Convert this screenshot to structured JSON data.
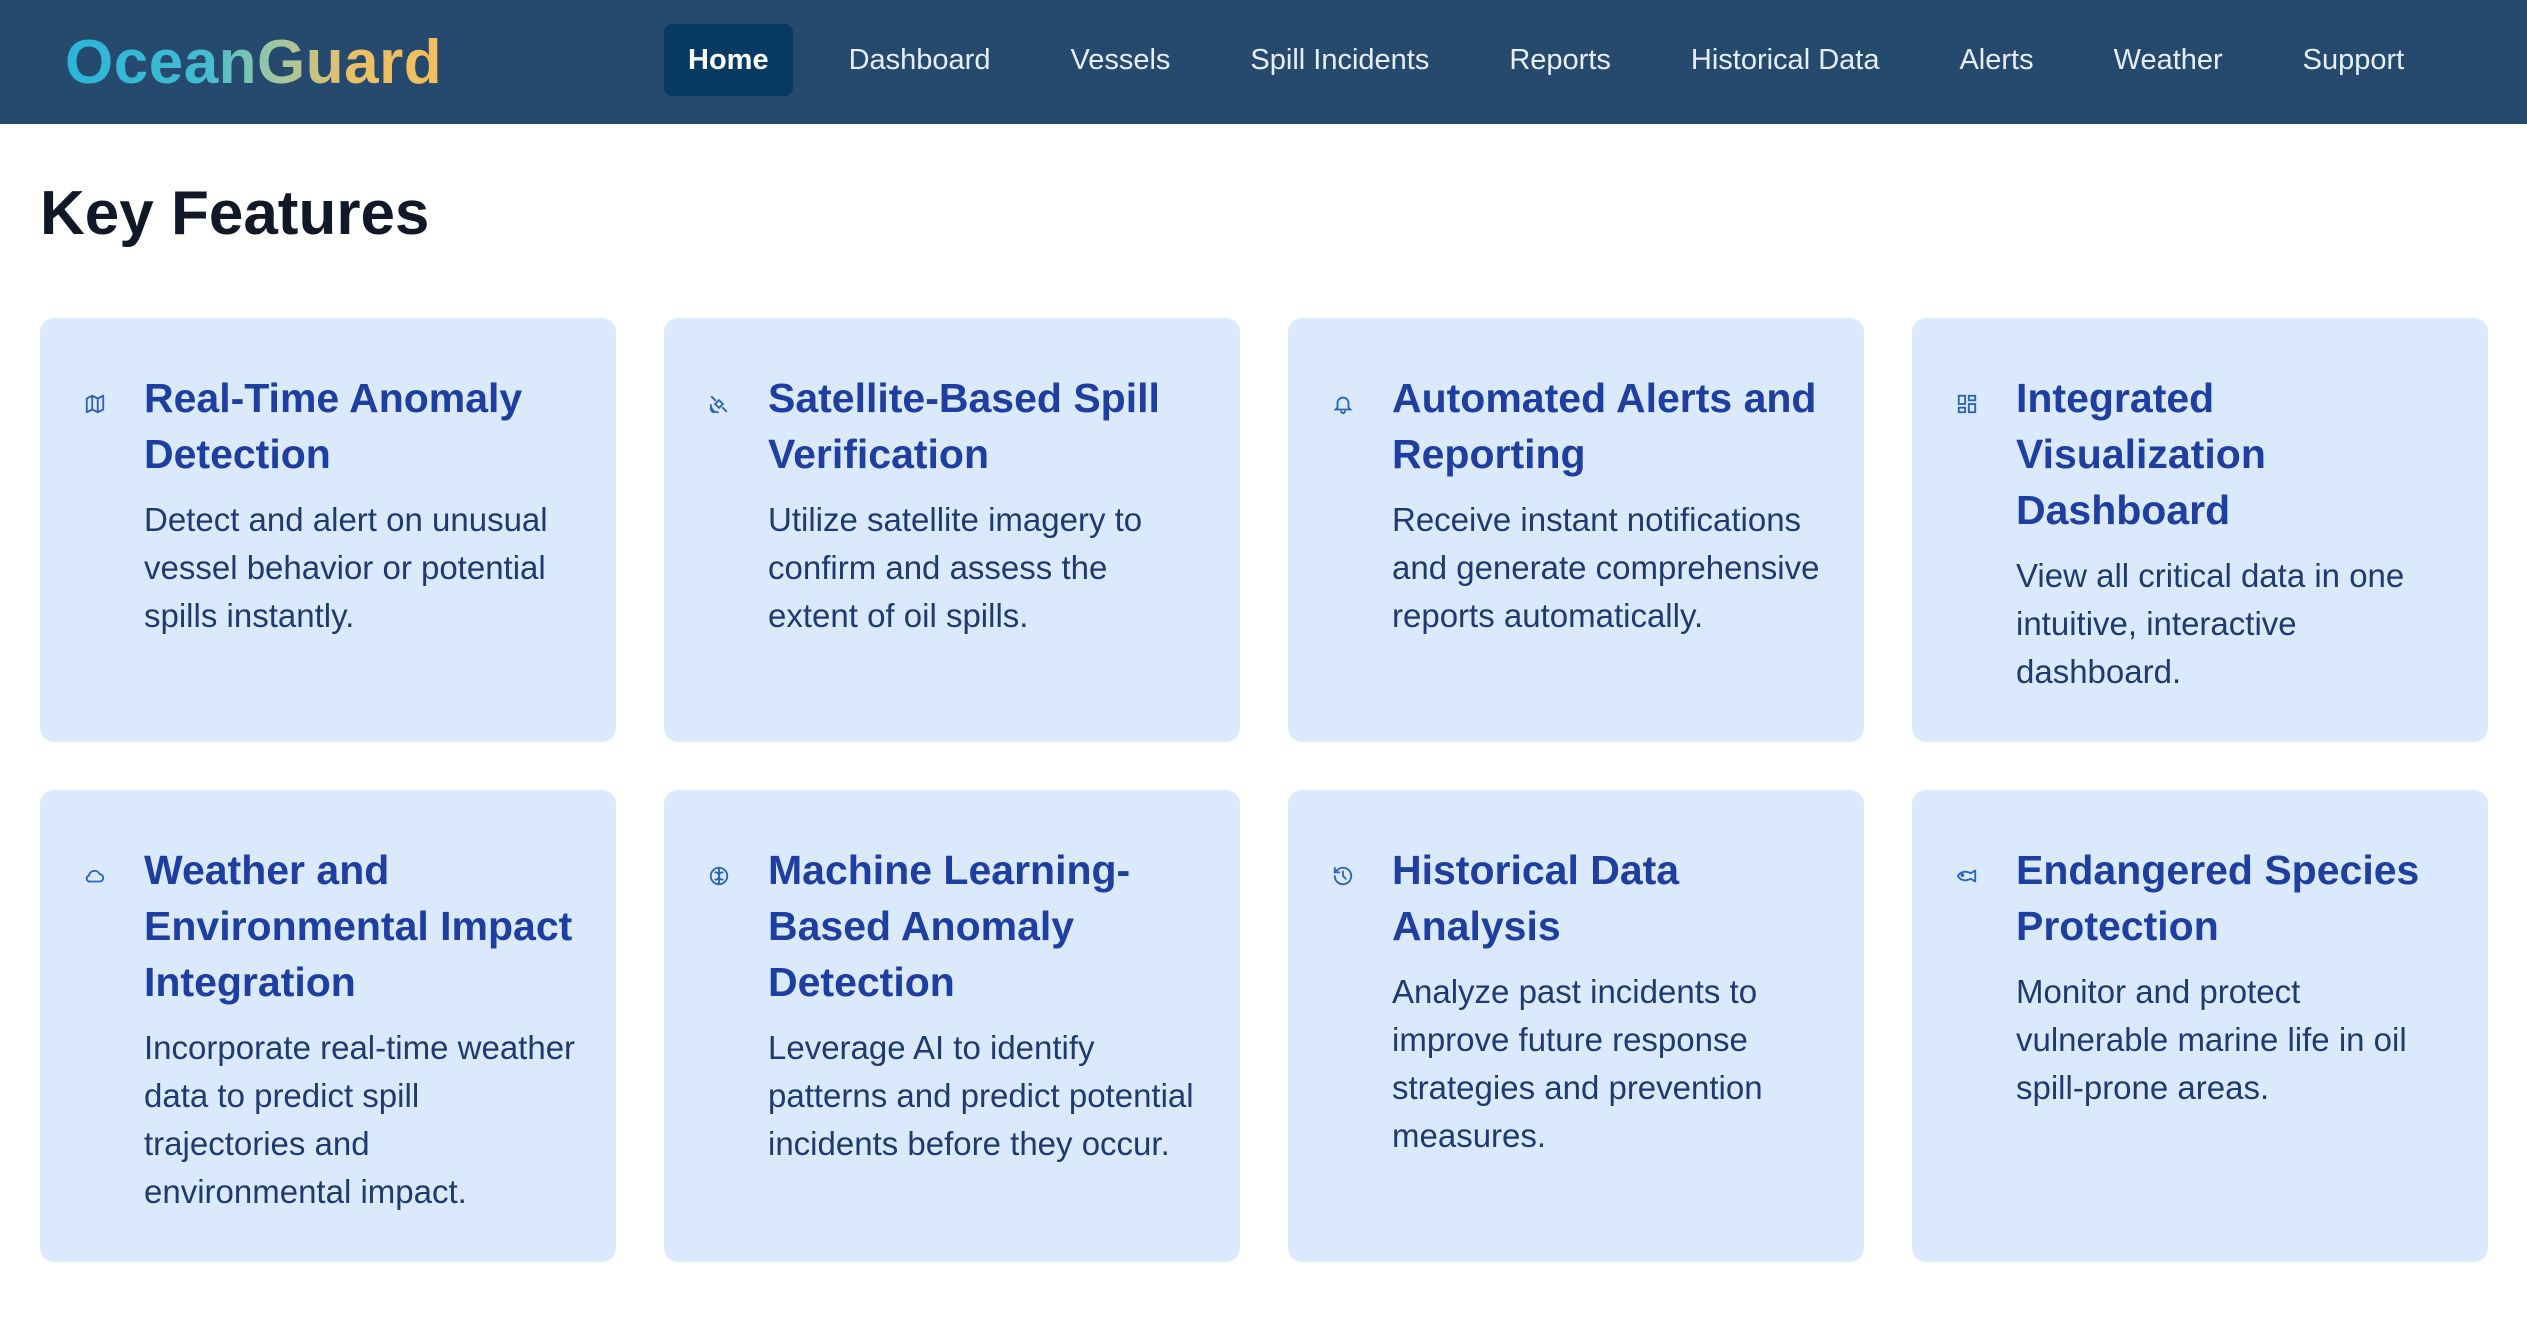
{
  "brand": {
    "name": "OceanGuard"
  },
  "nav": {
    "items": [
      {
        "label": "Home",
        "active": true
      },
      {
        "label": "Dashboard"
      },
      {
        "label": "Vessels"
      },
      {
        "label": "Spill Incidents"
      },
      {
        "label": "Reports"
      },
      {
        "label": "Historical Data"
      },
      {
        "label": "Alerts"
      },
      {
        "label": "Weather"
      },
      {
        "label": "Support"
      }
    ]
  },
  "page": {
    "title": "Key Features"
  },
  "features": [
    {
      "icon": "map-icon",
      "title": "Real-Time Anomaly Detection",
      "description": "Detect and alert on unusual vessel behavior or potential spills instantly."
    },
    {
      "icon": "satellite-icon",
      "title": "Satellite-Based Spill Verification",
      "description": "Utilize satellite imagery to confirm and assess the extent of oil spills."
    },
    {
      "icon": "bell-icon",
      "title": "Automated Alerts and Reporting",
      "description": "Receive instant notifications and generate comprehensive reports automatically."
    },
    {
      "icon": "dashboard-icon",
      "title": "Integrated Visualization Dashboard",
      "description": "View all critical data in one intuitive, interactive dashboard."
    },
    {
      "icon": "cloud-icon",
      "title": "Weather and Environmental Impact Integration",
      "description": "Incorporate real-time weather data to predict spill trajectories and environmental impact."
    },
    {
      "icon": "brain-icon",
      "title": "Machine Learning-Based Anomaly Detection",
      "description": "Leverage AI to identify patterns and predict potential incidents before they occur."
    },
    {
      "icon": "history-icon",
      "title": "Historical Data Analysis",
      "description": "Analyze past incidents to improve future response strategies and prevention measures."
    },
    {
      "icon": "fish-icon",
      "title": "Endangered Species Protection",
      "description": "Monitor and protect vulnerable marine life in oil spill-prone areas."
    }
  ],
  "colors": {
    "nav_bg": "#254a6e",
    "nav_active_bg": "#073a63",
    "card_bg": "#dbe9fd",
    "card_title": "#1e3ea0",
    "card_text": "#1f3a6e"
  }
}
